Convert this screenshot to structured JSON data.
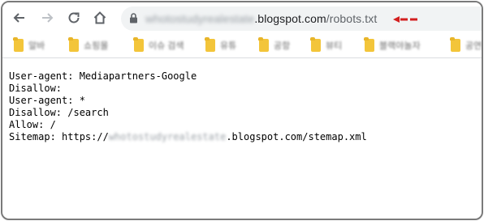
{
  "browser": {
    "url_blurred": "whotostudyrealestate",
    "url_domain": ".blogspot.com",
    "url_path": "/robots.txt",
    "accent_red": "#d31f1f"
  },
  "bookmarks": [
    {
      "label": "알바"
    },
    {
      "label": "쇼핑몰"
    },
    {
      "label": "이슈 검색"
    },
    {
      "label": "유튜"
    },
    {
      "label": "공항"
    },
    {
      "label": "뷰티"
    },
    {
      "label": "블랙야놀자"
    },
    {
      "label": "공연"
    }
  ],
  "robots": {
    "line1": "User-agent: Mediapartners-Google",
    "line2": "Disallow:",
    "line3": "User-agent: *",
    "line4": "Disallow: /search",
    "line5": "Allow: /",
    "sitemap_prefix": "Sitemap: https://",
    "sitemap_blurred": "whotostudyrealestate",
    "sitemap_suffix": ".blogspot.com/stemap.xml"
  }
}
